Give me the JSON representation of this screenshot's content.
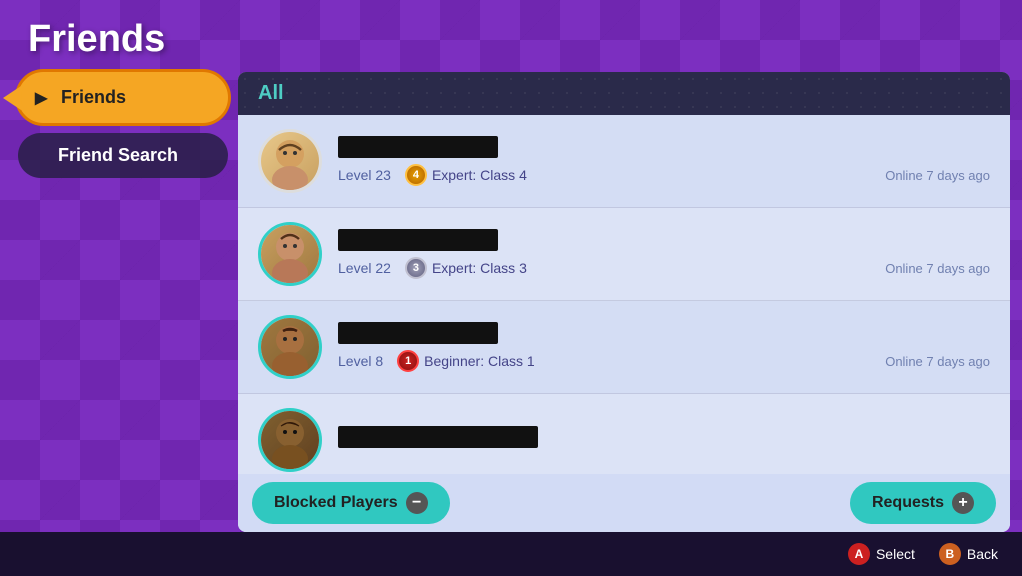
{
  "page": {
    "title": "Friends",
    "bg_color": "#7c2fc0"
  },
  "sidebar": {
    "items": [
      {
        "id": "friends",
        "label": "Friends",
        "active": true
      },
      {
        "id": "friend-search",
        "label": "Friend Search",
        "active": false
      }
    ]
  },
  "main_panel": {
    "header": "All",
    "friends": [
      {
        "id": 1,
        "name_redacted": true,
        "level": "Level 23",
        "rank_num": 4,
        "rank_label": "Expert: Class 4",
        "status": "Online 7 days ago",
        "avatar_class": "avatar-1",
        "border": "white-border"
      },
      {
        "id": 2,
        "name_redacted": true,
        "level": "Level 22",
        "rank_num": 3,
        "rank_label": "Expert: Class 3",
        "status": "Online 7 days ago",
        "avatar_class": "avatar-2",
        "border": "teal-border"
      },
      {
        "id": 3,
        "name_redacted": true,
        "level": "Level 8",
        "rank_num": 1,
        "rank_label": "Beginner: Class 1",
        "status": "Online 7 days ago",
        "avatar_class": "avatar-3",
        "border": "teal-border"
      },
      {
        "id": 4,
        "name_redacted": true,
        "level": "",
        "rank_num": null,
        "rank_label": "",
        "status": "",
        "avatar_class": "avatar-4",
        "border": "teal-border"
      }
    ],
    "actions": {
      "blocked_label": "Blocked Players",
      "requests_label": "Requests"
    }
  },
  "bottom_bar": {
    "select_label": "Select",
    "back_label": "Back",
    "select_btn": "A",
    "back_btn": "B"
  }
}
